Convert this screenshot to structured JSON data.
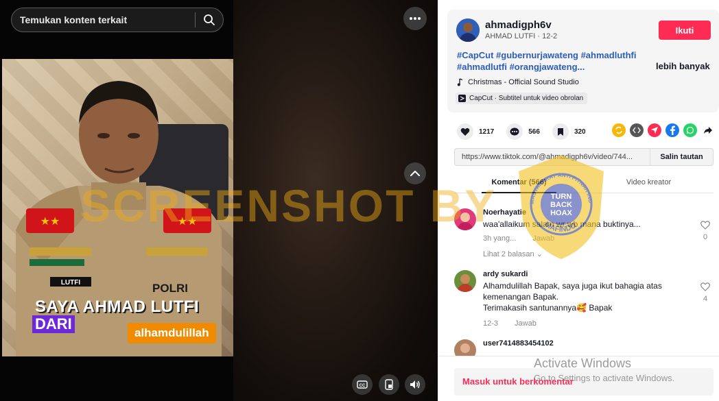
{
  "search": {
    "placeholder": "Temukan konten terkait"
  },
  "video": {
    "caption_line1": "SAYA AHMAD LUTFI",
    "caption_line2": "DARI",
    "caption_tag": "alhamdulillah",
    "uniform_name": "LUTFI",
    "uniform_polri": "POLRI"
  },
  "watermark": {
    "text": "SCREENSHOT BY",
    "badge_line1": "TURN",
    "badge_line2": "BACK",
    "badge_line3": "HOAX",
    "badge_ring_top": "MASYARAKAT ANTI FITNAH INDONESIA",
    "badge_ring_bottom": "MAFINDO"
  },
  "author": {
    "username": "ahmadigph6v",
    "display_line": "AHMAD LUTFI · 12-2",
    "follow_label": "Ikuti"
  },
  "description": {
    "hashtags": "#CapCut #gubernurjawateng #ahmadluthfi #ahmadlutfi #orangjawateng...",
    "more_label": "lebih banyak",
    "music": "Christmas - Official Sound Studio",
    "capcut": "CapCut · Subtitel untuk video obrolan"
  },
  "stats": {
    "likes": "1217",
    "comments": "566",
    "saves": "320"
  },
  "share_link": {
    "url": "https://www.tiktok.com/@ahmadigph6v/video/744...",
    "copy_label": "Salin tautan"
  },
  "tabs": {
    "comments_label": "Komentar (566)",
    "creator_videos_label": "Video kreator"
  },
  "comments": [
    {
      "name": "Noerhayatie",
      "text": "waa'allaikum salam wr wb mana buktinya...",
      "time": "3h yang...",
      "reply": "Jawab",
      "likes": "0",
      "view_replies": "Lihat 2 balasan"
    },
    {
      "name": "ardy sukardi",
      "text_line1": "Alhamdulillah Bapak, saya juga ikut bahagia atas",
      "text_line2": "kemenangan Bapak.",
      "text_line3": "Terimakasih santunannya🥰 Bapak",
      "time": "12-3",
      "reply": "Jawab",
      "likes": "4"
    },
    {
      "name": "user7414883454102"
    }
  ],
  "footer": {
    "login_label": "Masuk untuk berkomentar",
    "activate_title": "Activate Windows",
    "activate_sub": "Go to Settings to activate Windows."
  },
  "colors": {
    "accent": "#fe2c55",
    "hashtag": "#2b5db9",
    "watermark": "#f0aa14"
  }
}
